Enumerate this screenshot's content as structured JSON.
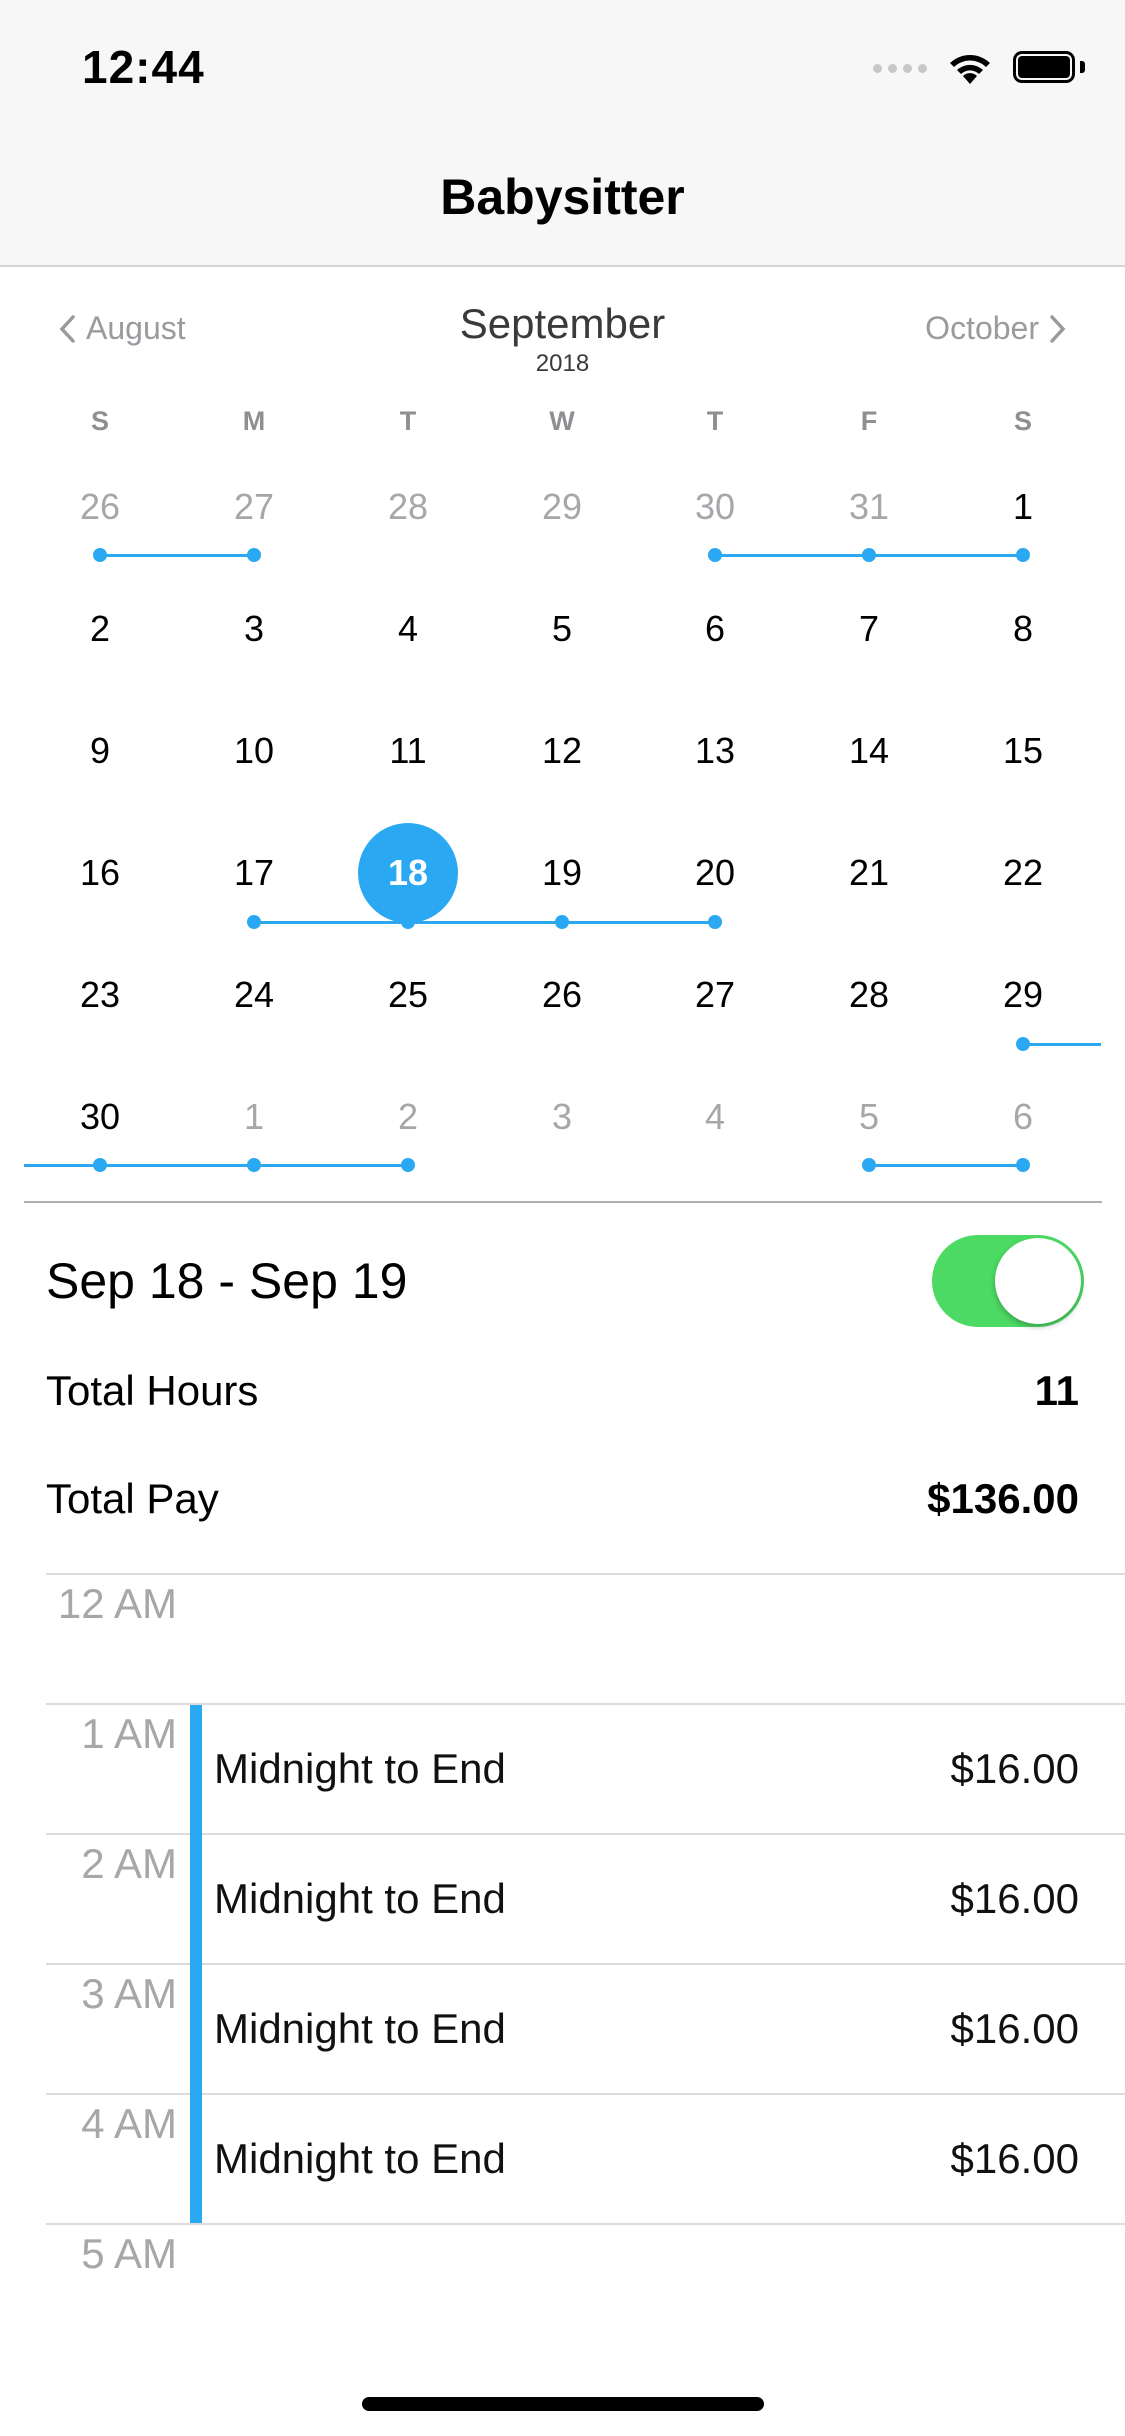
{
  "status_bar": {
    "time": "12:44"
  },
  "nav": {
    "title": "Babysitter"
  },
  "calendar": {
    "prev_month": "August",
    "month": "September",
    "year": "2018",
    "next_month": "October",
    "weekdays": [
      "S",
      "M",
      "T",
      "W",
      "T",
      "F",
      "S"
    ],
    "weeks": [
      [
        "26",
        "27",
        "28",
        "29",
        "30",
        "31",
        "1"
      ],
      [
        "2",
        "3",
        "4",
        "5",
        "6",
        "7",
        "8"
      ],
      [
        "9",
        "10",
        "11",
        "12",
        "13",
        "14",
        "15"
      ],
      [
        "16",
        "17",
        "18",
        "19",
        "20",
        "21",
        "22"
      ],
      [
        "23",
        "24",
        "25",
        "26",
        "27",
        "28",
        "29"
      ],
      [
        "30",
        "1",
        "2",
        "3",
        "4",
        "5",
        "6"
      ]
    ],
    "selected_day": "18",
    "accent_color": "#2aa8f2"
  },
  "summary": {
    "range": "Sep 18 - Sep 19",
    "toggle_on": true,
    "total_hours_label": "Total Hours",
    "total_hours_value": "11",
    "total_pay_label": "Total Pay",
    "total_pay_value": "$136.00"
  },
  "schedule": {
    "hours": [
      "12 AM",
      "1 AM",
      "2 AM",
      "3 AM",
      "4 AM",
      "5 AM"
    ],
    "entries": [
      {
        "label": "Midnight to End",
        "amount": "$16.00"
      },
      {
        "label": "Midnight to End",
        "amount": "$16.00"
      },
      {
        "label": "Midnight to End",
        "amount": "$16.00"
      },
      {
        "label": "Midnight to End",
        "amount": "$16.00"
      }
    ]
  }
}
